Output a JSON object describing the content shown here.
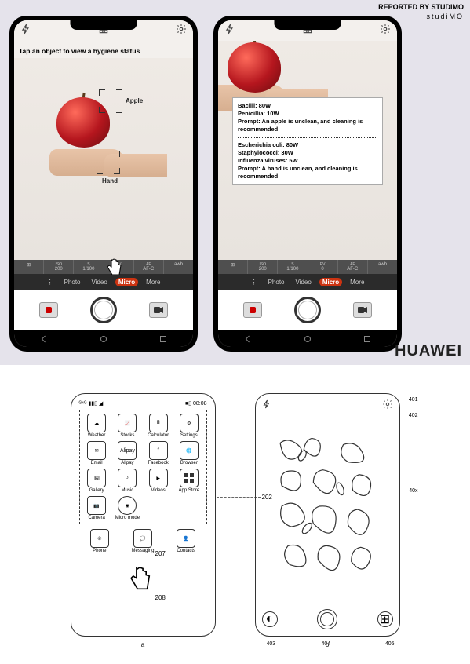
{
  "credit": {
    "line1": "REPORTED BY STUDIMO",
    "line2": "studiMO"
  },
  "brand": "HUAWEI",
  "phone1": {
    "instruction": "Tap an object to view a hygiene status",
    "label_apple": "Apple",
    "label_hand": "Hand",
    "meta": {
      "iso_l": "ISO",
      "iso": "200",
      "s_l": "S",
      "s": "1/100",
      "ev_l": "EV",
      "ev": "0",
      "af_l": "AF",
      "af": "AF-C",
      "awb_l": "",
      "awb": "awb"
    },
    "modes": {
      "photo": "Photo",
      "video": "Video",
      "micro": "Micro",
      "more": "More"
    }
  },
  "phone2": {
    "overlay": {
      "bacilli": "Bacilli: 80W",
      "penicillia": "Penicillia: 10W",
      "prompt1": "Prompt: An apple is unclean, and cleaning is recommended",
      "ecoli": "Escherichia coli: 80W",
      "staph": "Staphylococci: 30W",
      "flu": "Influenza viruses: 5W",
      "prompt2": "Prompt: A hand is unclean, and cleaning is recommended"
    },
    "modes": {
      "photo": "Photo",
      "video": "Video",
      "micro": "Micro",
      "more": "More"
    }
  },
  "patent_a": {
    "time": "08:08",
    "apps": {
      "weather": "Weather",
      "stocks": "Stocks",
      "calc": "Calculator",
      "settings": "Settings",
      "email": "Email",
      "alipay": "Alipay",
      "facebook": "Facebook",
      "browser": "Browser",
      "gallery": "Gallery",
      "music": "Music",
      "videos": "Videos",
      "appstore": "App Store",
      "camera": "Camera",
      "micromode": "Micro mode",
      "phone": "Phone",
      "messaging": "Messaging",
      "contacts": "Contacts"
    },
    "callouts": {
      "c202": "202",
      "c207": "207",
      "c208": "208"
    },
    "fig": "a"
  },
  "patent_b": {
    "callouts": {
      "c401": "401",
      "c402": "402",
      "c40x": "40x",
      "c403": "403",
      "c404": "404",
      "c405": "405"
    },
    "fig": "b"
  }
}
